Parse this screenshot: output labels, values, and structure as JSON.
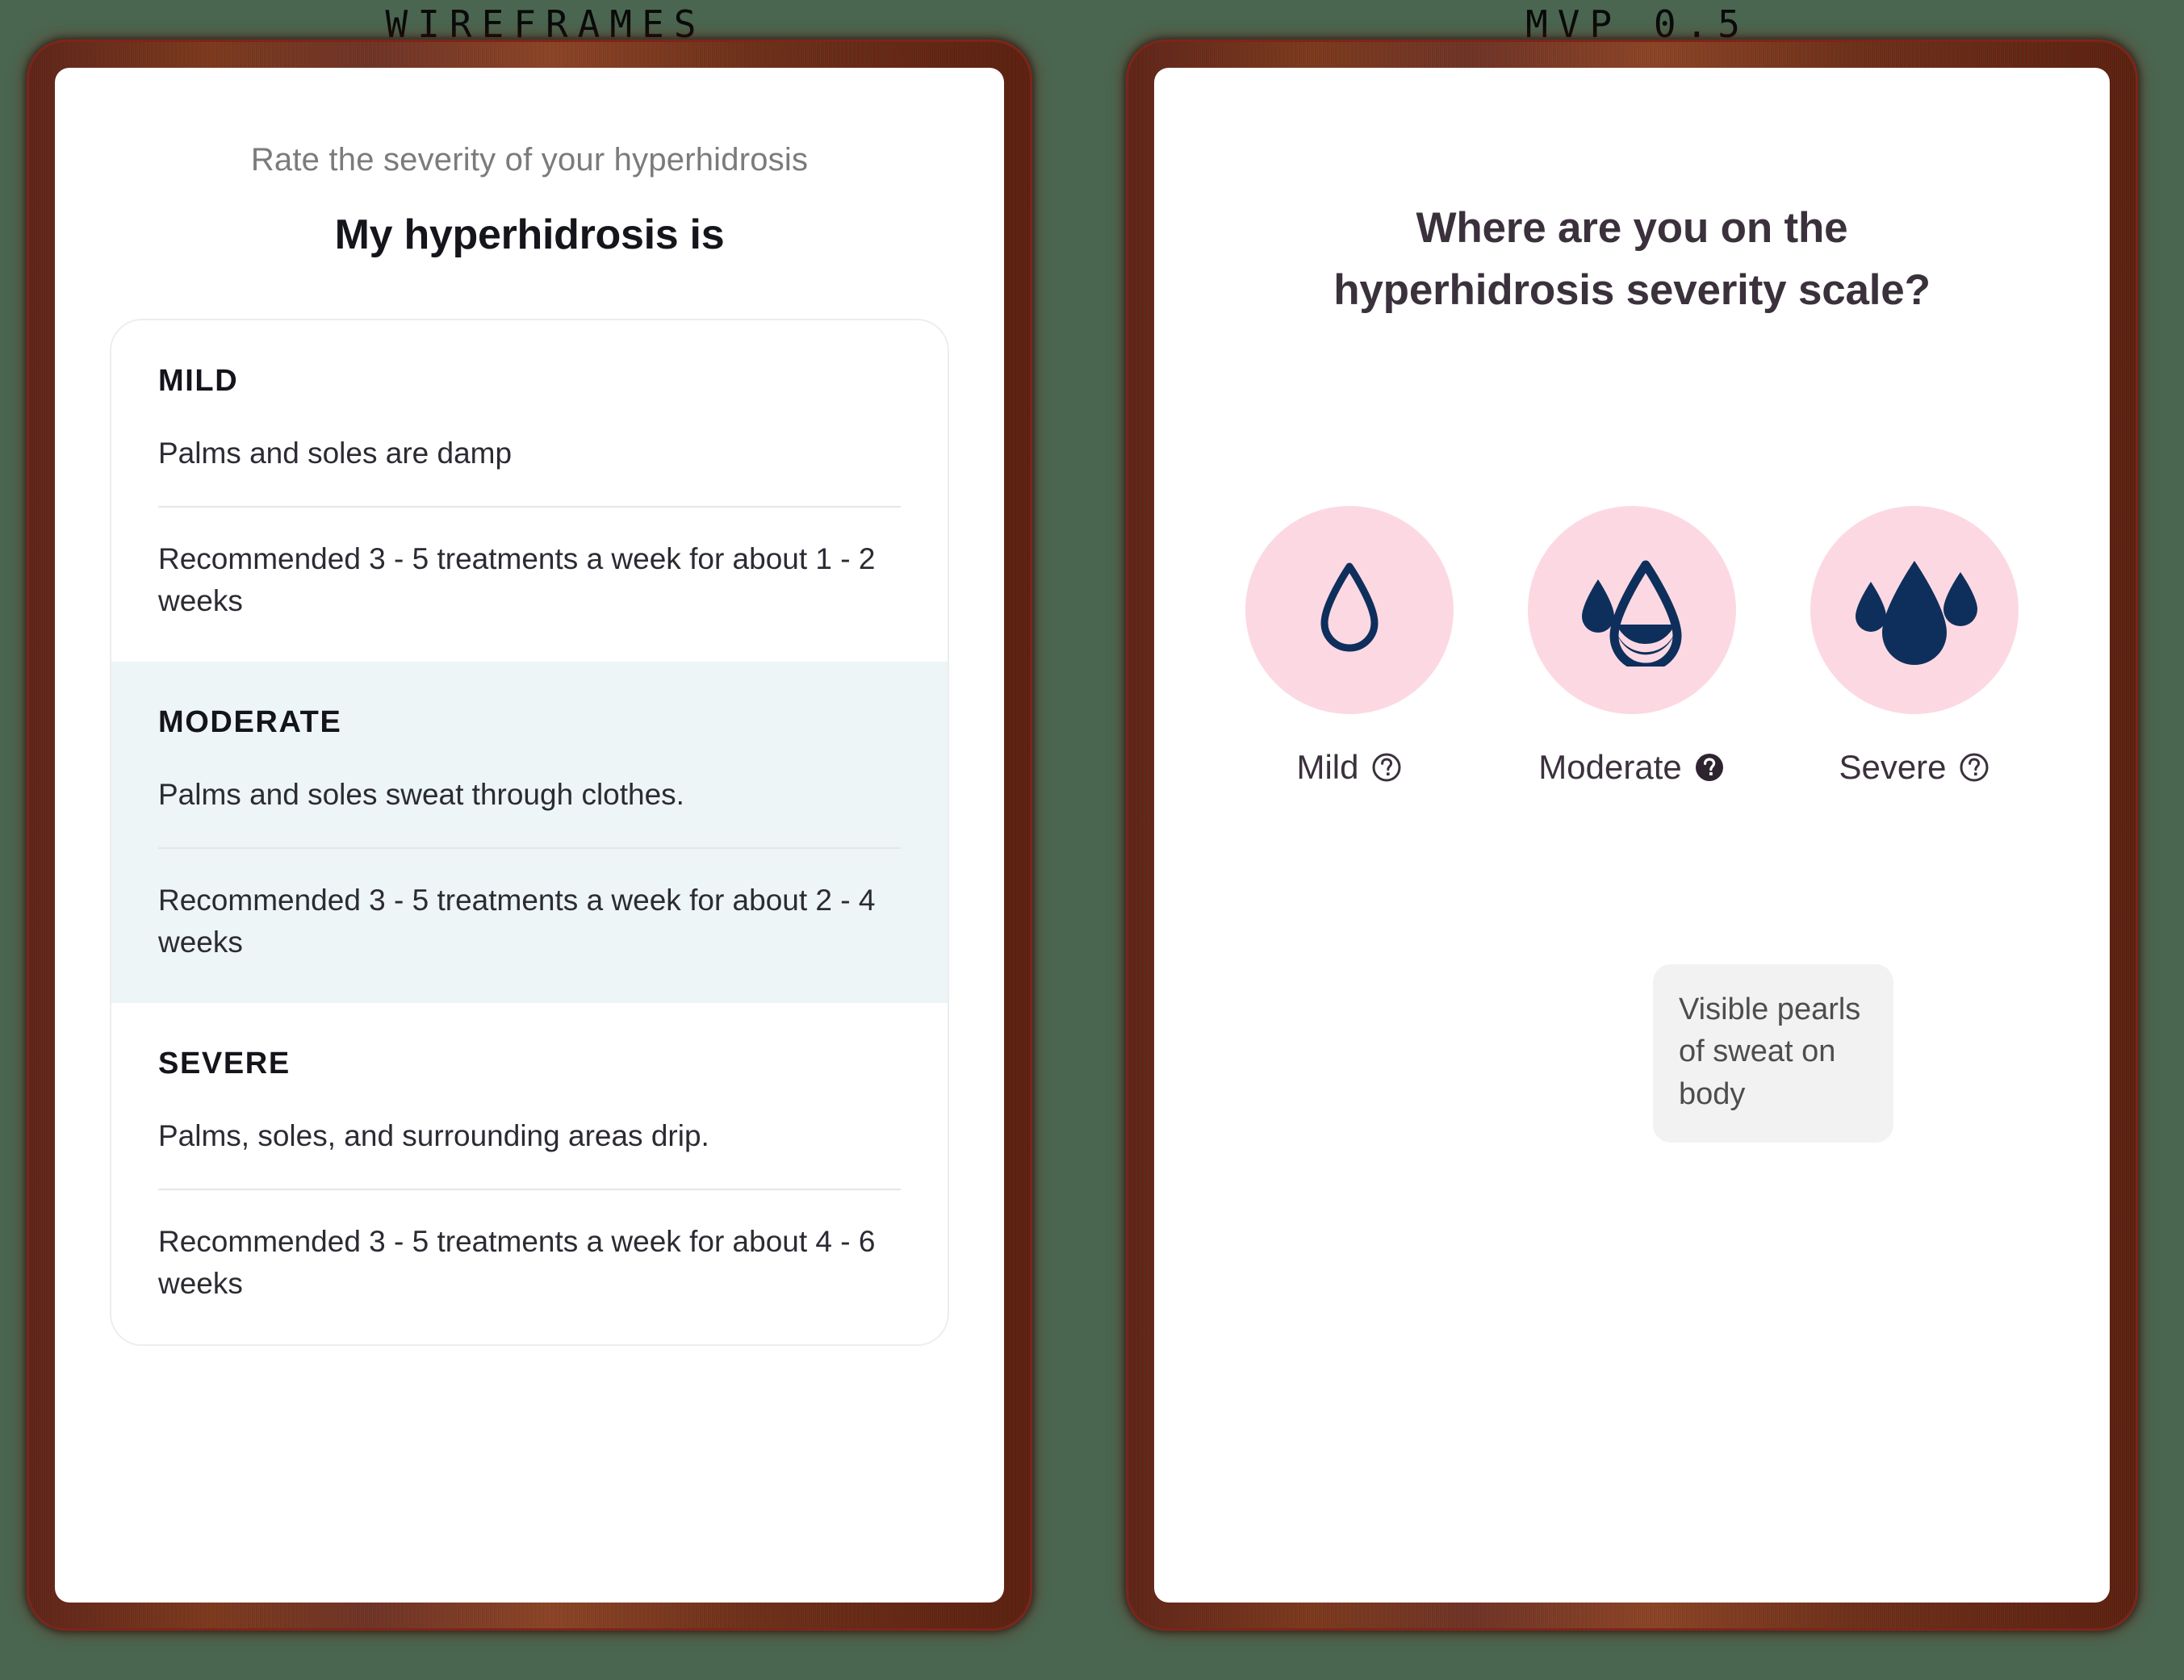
{
  "page": {
    "background_color": "#4a6650",
    "frame_color": "#6c3018",
    "accent_pink": "#fcd9e2",
    "accent_navy": "#0e2f5c",
    "highlight_color": "#edf5f6"
  },
  "captions": {
    "left": "WIREFRAMES",
    "right": "MVP 0.5"
  },
  "left_screen": {
    "eyebrow": "Rate the severity of your hyperhidrosis",
    "title": "My hyperhidrosis is",
    "levels": [
      {
        "label": "MILD",
        "description": "Palms and soles are damp",
        "recommendation": "Recommended 3 - 5 treatments a week for about 1 - 2 weeks",
        "selected": false
      },
      {
        "label": "MODERATE",
        "description": "Palms and soles sweat through clothes.",
        "recommendation": "Recommended 3 - 5 treatments a week for about 2 - 4 weeks",
        "selected": true
      },
      {
        "label": "SEVERE",
        "description": "Palms, soles, and surrounding areas drip.",
        "recommendation": "Recommended 3 - 5 treatments a week for about 4 - 6 weeks",
        "selected": false
      }
    ]
  },
  "right_screen": {
    "title_line_1": "Where are you on the",
    "title_line_2": "hyperhidrosis severity scale?",
    "options": [
      {
        "label": "Mild",
        "icon": "one-droplet-outline-icon",
        "help_icon": "help-circle-outline-icon",
        "help_active": false
      },
      {
        "label": "Moderate",
        "icon": "two-droplets-icon",
        "help_icon": "help-circle-filled-icon",
        "help_active": true
      },
      {
        "label": "Severe",
        "icon": "three-droplets-icon",
        "help_icon": "help-circle-outline-icon",
        "help_active": false
      }
    ],
    "tooltip": {
      "text": "Visible pearls of sweat on body",
      "anchor_option": "Moderate"
    }
  }
}
